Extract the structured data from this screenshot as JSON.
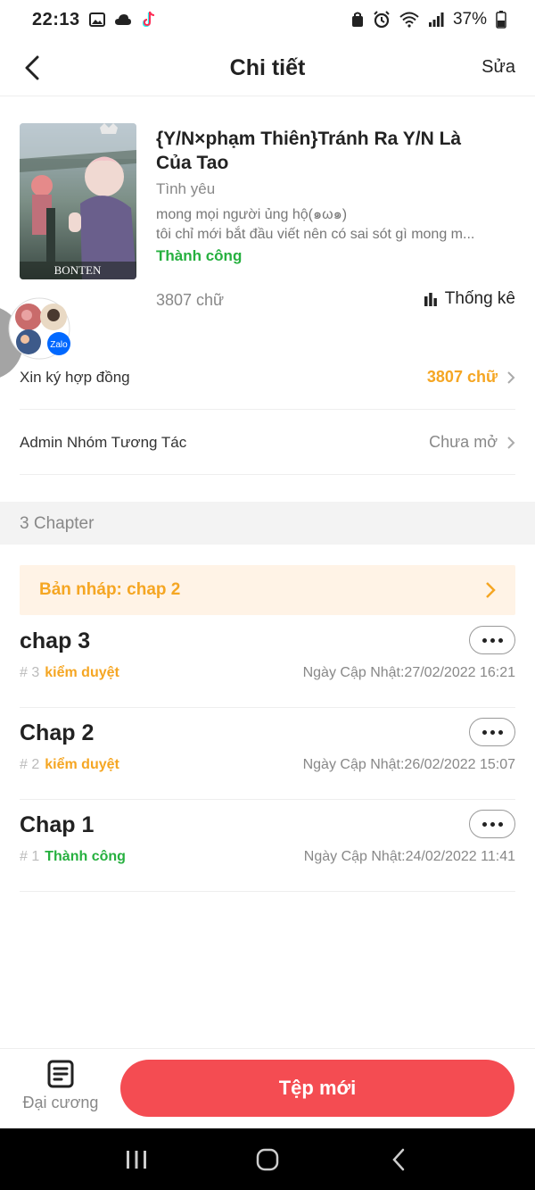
{
  "status_bar": {
    "time": "22:13",
    "battery": "37%",
    "icons": [
      "image-icon",
      "cloud-icon",
      "tiktok-icon",
      "lock-battery-icon",
      "alarm-icon",
      "wifi-icon",
      "signal-icon",
      "battery-icon"
    ]
  },
  "header": {
    "title": "Chi tiết",
    "edit_label": "Sửa"
  },
  "story": {
    "cover_label": "BONTEN",
    "title": "{Y/N×phạm Thiên}Tránh Ra Y/N Là Của Tao",
    "genre": "Tình yêu",
    "desc_line1": "mong mọi người ủng hộ(๑ω๑)",
    "desc_line2": "tôi chỉ mới bắt đầu viết nên có sai sót gì mong m...",
    "status": "Thành công",
    "word_count": "3807 chữ",
    "stats_label": "Thống kê"
  },
  "bubble": {
    "badge": "Zalo"
  },
  "rows": {
    "contract_label": "Xin ký hợp đồng",
    "contract_value": "3807 chữ",
    "admin_label": "Admin Nhóm Tương Tác",
    "admin_value": "Chưa mở"
  },
  "chapters_section": {
    "label": "3 Chapter",
    "draft": "Bản nháp: chap 2",
    "items": [
      {
        "title": "chap 3",
        "num": "# 3",
        "status": "kiểm duyệt",
        "date": "Ngày Cập Nhật:27/02/2022 16:21"
      },
      {
        "title": "Chap 2",
        "num": "# 2",
        "status": "kiểm duyệt",
        "date": "Ngày Cập Nhật:26/02/2022 15:07"
      },
      {
        "title": "Chap 1",
        "num": "# 1",
        "status": "Thành công",
        "date": "Ngày Cập Nhật:24/02/2022 11:41"
      }
    ]
  },
  "bottom": {
    "outline_label": "Đại cương",
    "new_file_label": "Tệp mới"
  },
  "colors": {
    "accent_red": "#f44c52",
    "orange": "#f5a623",
    "green": "#26b03f"
  }
}
